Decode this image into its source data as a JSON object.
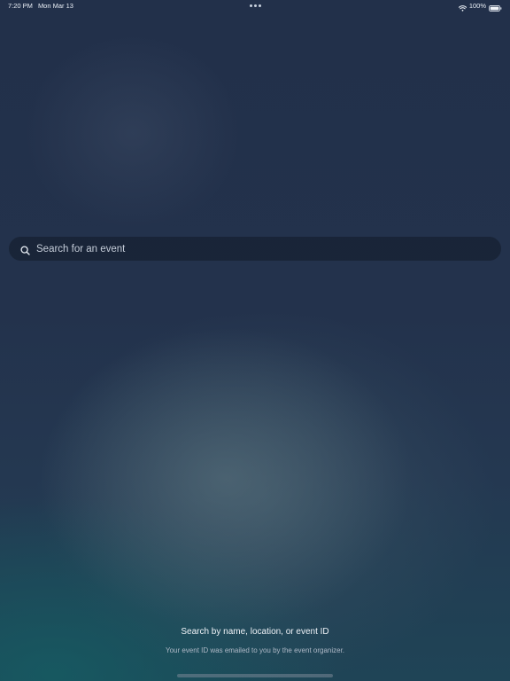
{
  "status_bar": {
    "time": "7:20 PM",
    "date": "Mon Mar 13",
    "battery": "100%",
    "icons": [
      "multitasking-dots-icon",
      "wifi-icon",
      "battery-icon"
    ]
  },
  "search": {
    "placeholder": "Search for an event",
    "value": "",
    "icon": "search-icon"
  },
  "hints": {
    "title": "Search by name, location, or event ID",
    "subtitle": "Your event ID was emailed to you by the event organizer."
  },
  "colors": {
    "background_top": "#22304a",
    "background_bottom_teal": "#1f4456",
    "search_bar_fill": "#162030"
  }
}
